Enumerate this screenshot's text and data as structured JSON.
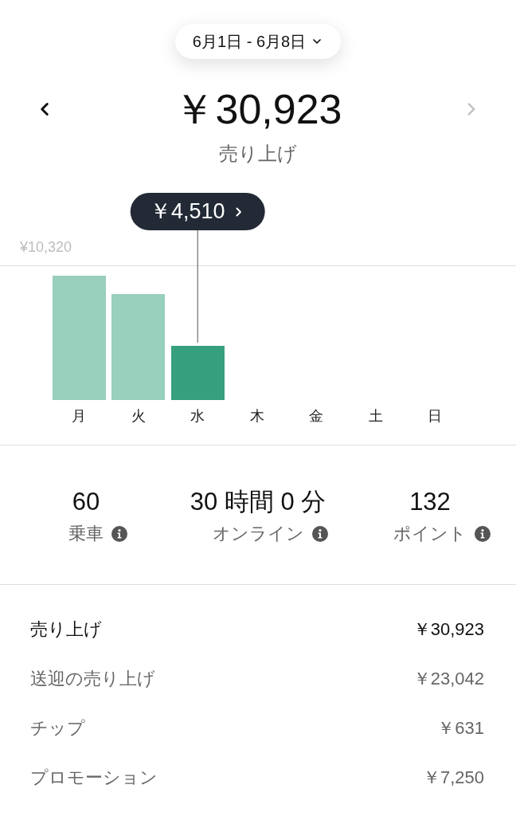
{
  "date_range": {
    "label": "6月1日 - 6月8日"
  },
  "nav": {
    "previous": {
      "disabled": false
    },
    "next": {
      "disabled": true
    }
  },
  "total": {
    "amount": "￥30,923",
    "label": "売り上げ"
  },
  "chart": {
    "tick_label": "¥10,320",
    "tooltip": "￥4,510",
    "days": [
      {
        "label": "月",
        "selected": false
      },
      {
        "label": "火",
        "selected": false
      },
      {
        "label": "水",
        "selected": true
      },
      {
        "label": "木",
        "selected": false
      },
      {
        "label": "金",
        "selected": false
      },
      {
        "label": "土",
        "selected": false
      },
      {
        "label": "日",
        "selected": false
      }
    ]
  },
  "stats": [
    {
      "value": "60",
      "label": "乗車"
    },
    {
      "value": "30 時間 0 分",
      "label": "オンライン"
    },
    {
      "value": "132",
      "label": "ポイント"
    }
  ],
  "breakdown": [
    {
      "kind": "total",
      "label": "売り上げ",
      "amount": "￥30,923"
    },
    {
      "kind": "item",
      "label": "送迎の売り上げ",
      "amount": "￥23,042"
    },
    {
      "kind": "item",
      "label": "チップ",
      "amount": "￥631"
    },
    {
      "kind": "item",
      "label": "プロモーション",
      "amount": "￥7,250"
    }
  ]
}
